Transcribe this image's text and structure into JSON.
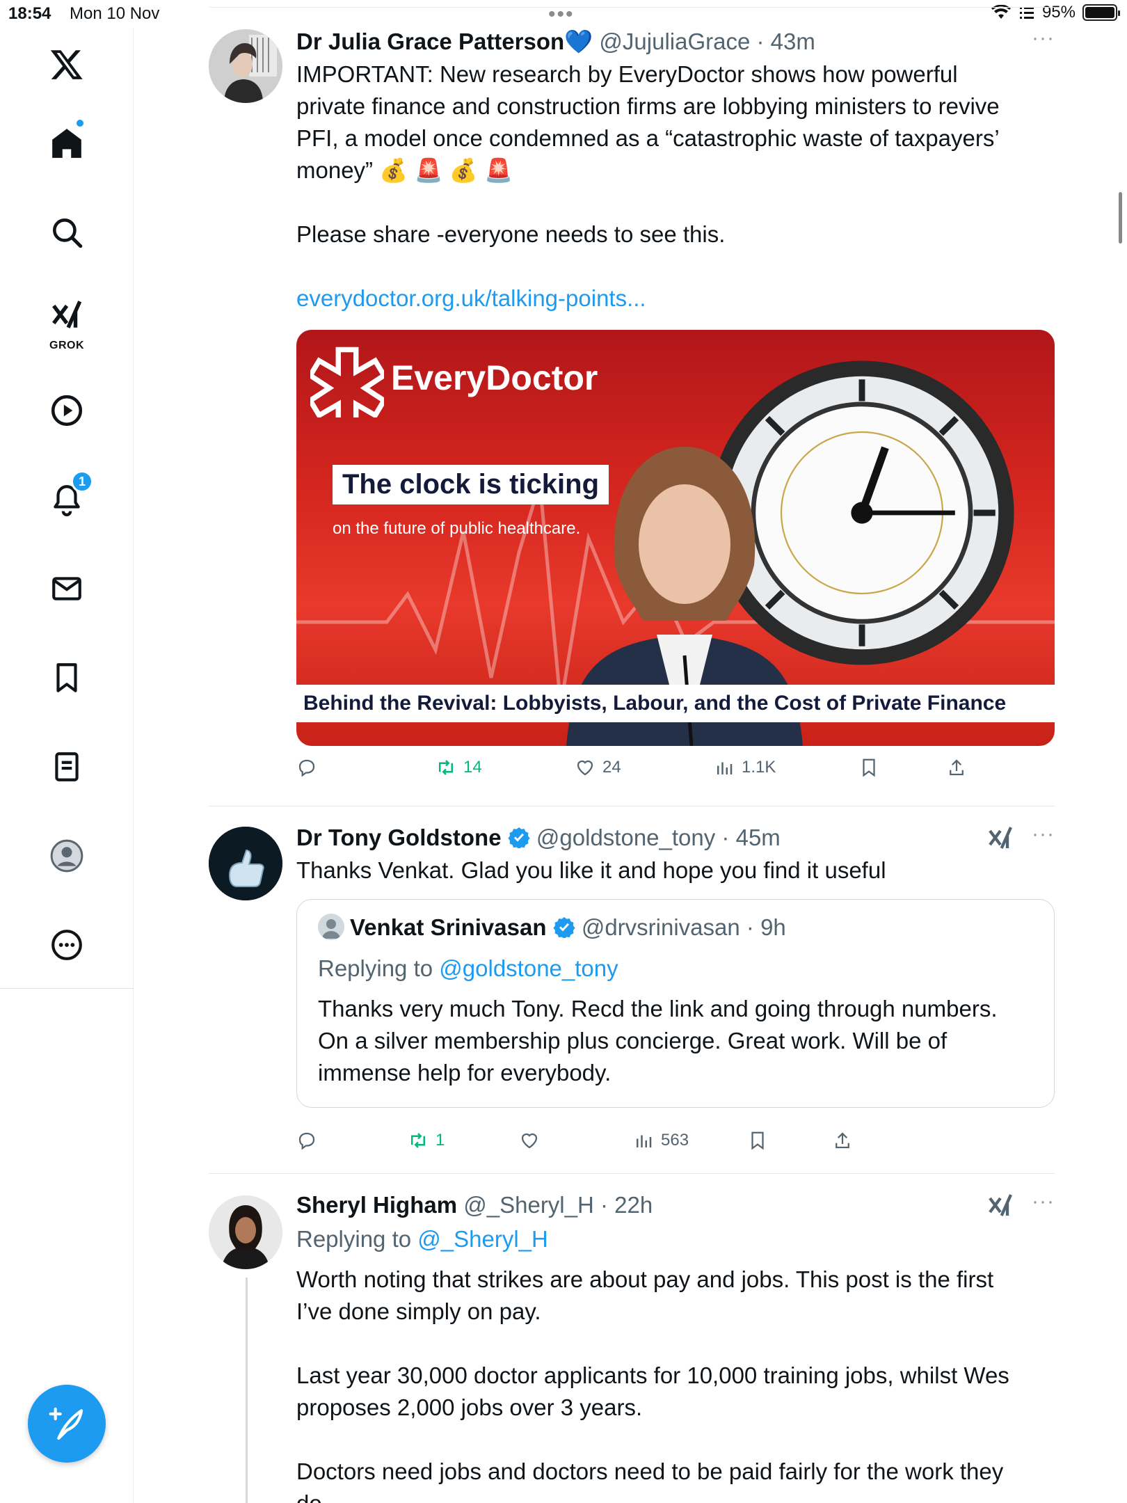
{
  "status_bar": {
    "time": "18:54",
    "date": "Mon 10 Nov",
    "battery": "95%"
  },
  "sidebar": {
    "grok_label": "GROK",
    "notifications_count": "1"
  },
  "tweets": [
    {
      "name": "Dr Julia Grace Patterson",
      "name_emoji": "💙",
      "handle": "@JujuliaGrace",
      "time": "43m",
      "more": "···",
      "lines": [
        "IMPORTANT: New research by EveryDoctor shows how powerful",
        "private finance and construction firms are lobbying ministers to revive",
        "PFI, a model once condemned as a “catastrophic waste of taxpayers’",
        "money” 💰 🚨 💰 🚨"
      ],
      "line2": "Please share -everyone needs to see this.",
      "link": "everydoctor.org.uk/talking-points...",
      "media": {
        "brand": "EveryDoctor",
        "headline": "The clock is ticking",
        "subhead": "on the future of public healthcare.",
        "caption": "Behind the Revival: Lobbyists, Labour, and the Cost of Private Finance"
      },
      "stats": {
        "replies": "",
        "retweets": "14",
        "likes": "24",
        "views": "1.1K"
      }
    },
    {
      "name": "Dr Tony Goldstone",
      "handle": "@goldstone_tony",
      "time": "45m",
      "more": "···",
      "text": "Thanks Venkat. Glad you like it and hope you find it useful",
      "quote": {
        "name": "Venkat Srinivasan",
        "handle": "@drvsrinivasan",
        "time": "9h",
        "replying_prefix": "Replying to",
        "replying_to": "@goldstone_tony",
        "lines": [
          "Thanks very much Tony. Recd the link and going through numbers.",
          "On a silver membership plus concierge. Great work. Will be of",
          "immense help for everybody."
        ]
      },
      "stats": {
        "replies": "",
        "retweets": "1",
        "likes": "",
        "views": "563"
      }
    },
    {
      "name": "Sheryl Higham",
      "handle": "@_Sheryl_H",
      "time": "22h",
      "more": "···",
      "replying_prefix": "Replying to",
      "replying_to": "@_Sheryl_H",
      "p1": [
        "Worth noting that strikes are about pay and jobs. This post is the first",
        "I’ve done simply on pay."
      ],
      "p2": [
        "Last year 30,000 doctor applicants for 10,000 training jobs, whilst Wes",
        "proposes 2,000 jobs over 3 years."
      ],
      "p3": [
        "Doctors need jobs and doctors need to be paid fairly for the work they",
        "do."
      ]
    }
  ],
  "colors": {
    "accent": "#1d9bf0",
    "retweet": "#00ba7c",
    "muted": "#536471"
  },
  "icons": [
    "x-logo-icon",
    "home-icon",
    "search-icon",
    "grok-icon",
    "video-icon",
    "bell-icon",
    "mail-icon",
    "bookmark-icon",
    "lists-icon",
    "profile-icon",
    "more-circle-icon",
    "compose-icon",
    "reply-icon",
    "retweet-icon",
    "like-icon",
    "views-icon",
    "share-icon",
    "verified-icon"
  ]
}
